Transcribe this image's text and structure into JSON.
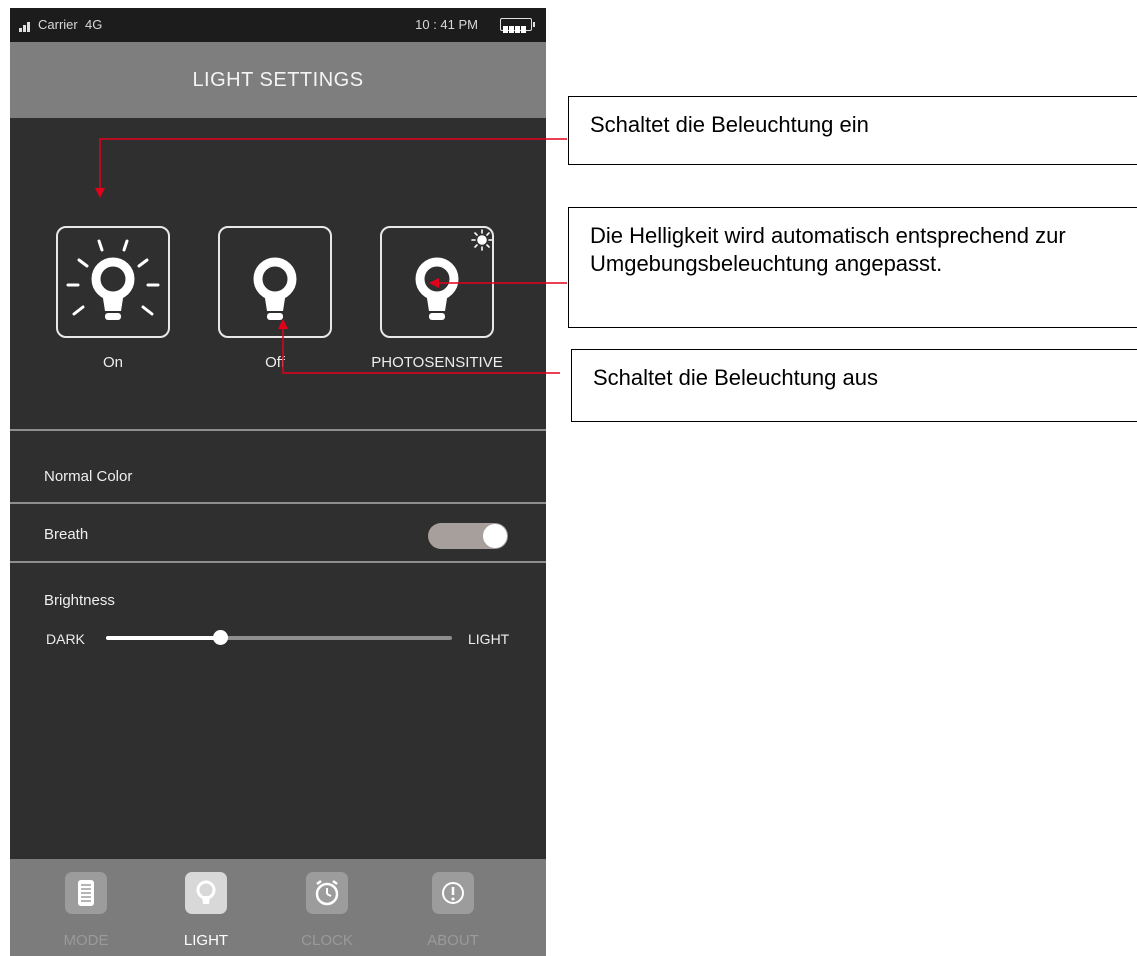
{
  "status_bar": {
    "carrier": "Carrier",
    "network": "4G",
    "time": "10 : 41 PM",
    "battery_icon": "battery-icon",
    "signal_icon": "signal-bars-icon"
  },
  "header": {
    "title": "LIGHT SETTINGS"
  },
  "light_modes": [
    {
      "label": "On",
      "icon": "bulb-on-icon"
    },
    {
      "label": "Off",
      "icon": "bulb-off-icon"
    },
    {
      "label": "PHOTOSENSITIVE",
      "icon": "bulb-photosensitive-icon"
    }
  ],
  "settings": {
    "normal_color_label": "Normal Color",
    "breath_label": "Breath",
    "breath_enabled": true,
    "brightness_label": "Brightness"
  },
  "brightness_slider": {
    "min_label": "DARK",
    "max_label": "LIGHT",
    "level": 0.33
  },
  "tabs": [
    {
      "label": "MODE",
      "icon": "mode-list-icon",
      "active": false
    },
    {
      "label": "LIGHT",
      "icon": "bulb-icon",
      "active": true
    },
    {
      "label": "CLOCK",
      "icon": "alarm-clock-icon",
      "active": false
    },
    {
      "label": "ABOUT",
      "icon": "info-icon",
      "active": false
    }
  ],
  "annotations": {
    "on_text": "Schaltet die Beleuchtung ein",
    "photosensitive_text": "Die Helligkeit wird automatisch entsprechend zur Umgebungsbeleuchtung angepasst.",
    "off_text": "Schaltet die Beleuchtung aus"
  },
  "colors": {
    "screen_background": "#2f2f2f",
    "header_background": "#7e7e7e",
    "tabbar_background": "#7c7c7c",
    "annotation_arrow": "#e2001a"
  }
}
